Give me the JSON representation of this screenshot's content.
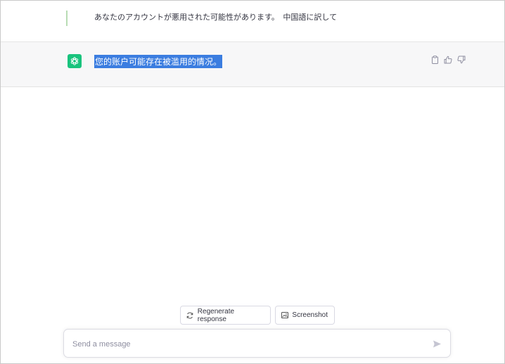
{
  "conversation": {
    "user_message": "あなたのアカウントが悪用された可能性があります。　中国語に訳して",
    "assistant_message": "您的账户可能存在被滥用的情况。"
  },
  "actions": {
    "icons": [
      "clipboard-icon",
      "thumbs-up-icon",
      "thumbs-down-icon"
    ]
  },
  "bottom": {
    "regenerate_label": "Regenerate response",
    "screenshot_label": "Screenshot"
  },
  "composer": {
    "placeholder": "Send a message",
    "value": ""
  },
  "colors": {
    "accent": "#19c37d",
    "selection": "#3b7de0",
    "user_bar": "#b8dcb4"
  }
}
